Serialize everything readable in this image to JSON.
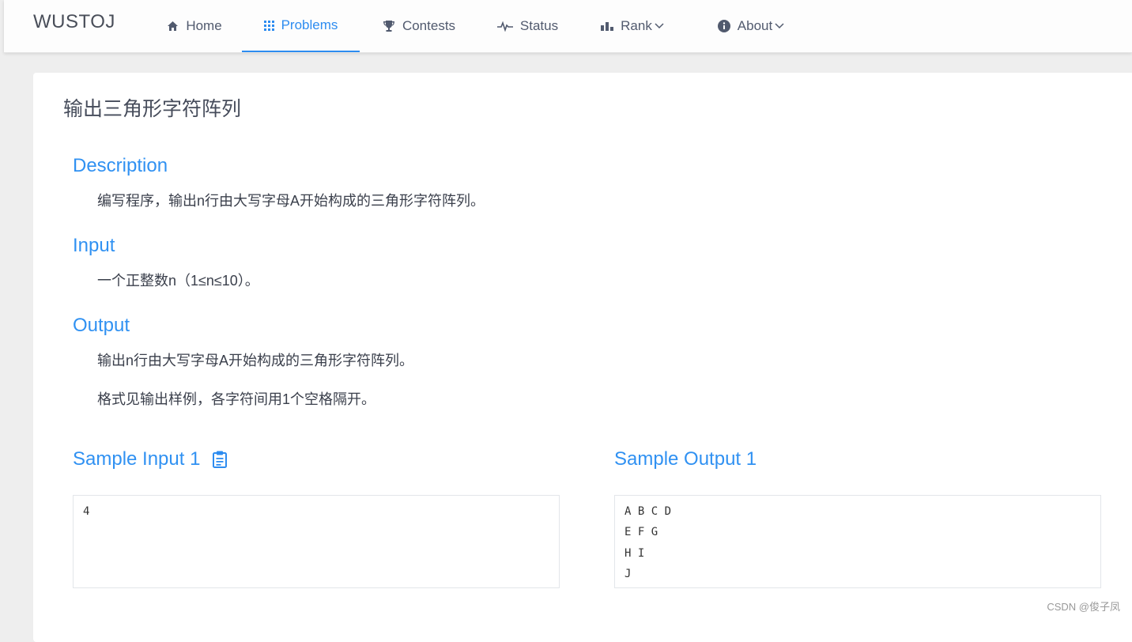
{
  "nav": {
    "logo": "WUSTOJ",
    "items": [
      {
        "label": "Home",
        "icon": "home-icon"
      },
      {
        "label": "Problems",
        "icon": "grid-icon",
        "active": true
      },
      {
        "label": "Contests",
        "icon": "trophy-icon"
      },
      {
        "label": "Status",
        "icon": "pulse-icon"
      },
      {
        "label": "Rank",
        "icon": "bar-chart-icon",
        "dropdown": true
      },
      {
        "label": "About",
        "icon": "info-icon",
        "dropdown": true
      }
    ],
    "accent": "#2d8cf0"
  },
  "problem": {
    "title": "输出三角形字符阵列",
    "description_heading": "Description",
    "description": "编写程序，输出n行由大写字母A开始构成的三角形字符阵列。",
    "input_heading": "Input",
    "input": "一个正整数n（1≤n≤10）。",
    "output_heading": "Output",
    "output_lines": [
      "输出n行由大写字母A开始构成的三角形字符阵列。",
      "格式见输出样例，各字符间用1个空格隔开。"
    ],
    "sample_input_heading": "Sample Input 1",
    "sample_output_heading": "Sample Output 1",
    "sample_input": [
      "4"
    ],
    "sample_output": [
      "A B C D",
      "E F G",
      "H I",
      "J"
    ]
  },
  "watermark": "CSDN @俊子凤"
}
